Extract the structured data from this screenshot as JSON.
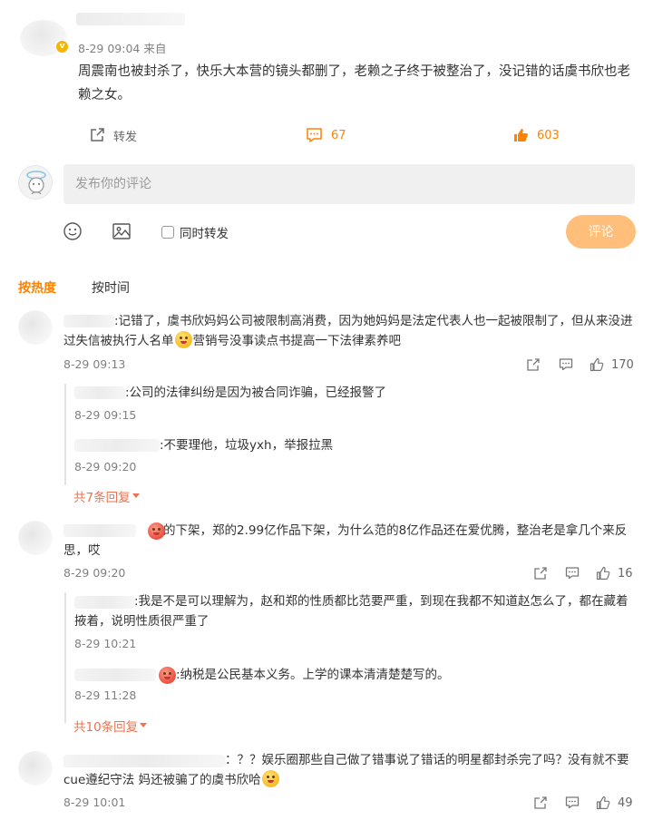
{
  "post": {
    "meta": "8-29 09:04  来自",
    "text": "周震南也被封杀了，快乐大本营的镜头都删了，老赖之子终于被整治了，没记错的话虞书欣也老赖之女。",
    "repost_label": "转发",
    "comment_count": "67",
    "like_count": "603"
  },
  "composer": {
    "placeholder": "发布你的评论",
    "repost_label": "同时转发",
    "submit_label": "评论"
  },
  "tabs": {
    "hot": "按热度",
    "time": "按时间"
  },
  "comments": [
    {
      "text_a": ":记错了，虞书欣妈妈公司被限制高消费，因为她妈妈是法定代表人也一起被限制了，但从来没进过失信被执行人名单",
      "text_b": "营销号没事读点书提高一下法律素养吧",
      "time": "8-29 09:13",
      "likes": "170",
      "replies": [
        {
          "text": ":公司的法律纠纷是因为被合同诈骗，已经报警了",
          "time": "8-29 09:15"
        },
        {
          "text": ":不要理他，垃圾yxh，举报拉黑",
          "time": "8-29 09:20"
        }
      ],
      "more": "共7条回复"
    },
    {
      "text_a": ":赵的下架，郑的2.99亿作品下架，为什么范的8亿作品还在爱优腾，整治老是拿几个来反思，哎",
      "time": "8-29 09:20",
      "likes": "16",
      "replies": [
        {
          "text": ":我是不是可以理解为，赵和郑的性质都比范要严重，到现在我都不知道赵怎么了，都在藏着掖着，说明性质很严重了",
          "time": "8-29 10:21"
        },
        {
          "text": ":纳税是公民基本义务。上学的课本清清楚楚写的。",
          "time": "8-29 11:28"
        }
      ],
      "more": "共10条回复"
    },
    {
      "text_a": "：？？娱乐圈那些自己做了错事说了错话的明星都封杀完了吗？没有就不要cue遵纪守法 妈还被骗了的虞书欣哈",
      "time": "8-29 10:01",
      "likes": "49"
    }
  ],
  "colors": {
    "accent": "#ff8200",
    "link": "#eb7350",
    "submit_bg": "#ffbe7a"
  }
}
